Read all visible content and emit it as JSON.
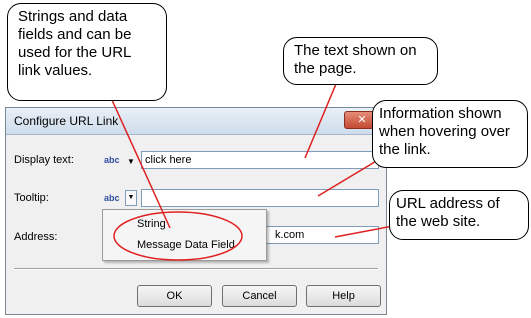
{
  "dialog": {
    "title": "Configure URL Link",
    "close_label": "✕",
    "display_text": {
      "label": "Display text:",
      "type_icon": "abc",
      "value": "click here"
    },
    "tooltip": {
      "label": "Tooltip:",
      "type_icon": "abc",
      "value": ""
    },
    "address": {
      "label": "Address:",
      "value": "k.com"
    },
    "popup_menu": {
      "items": [
        "String",
        "Message Data Field"
      ]
    },
    "buttons": {
      "ok": "OK",
      "cancel": "Cancel",
      "help": "Help"
    }
  },
  "callouts": {
    "strings": "Strings and data fields and can be used for the URL link values.",
    "text_shown": "The text shown on the page.",
    "info_hover": "Information shown when hovering over the link.",
    "url_address": "URL address of the web site."
  },
  "colors": {
    "highlight_ellipse": "#e02020",
    "pointer_line": "#e02020"
  }
}
